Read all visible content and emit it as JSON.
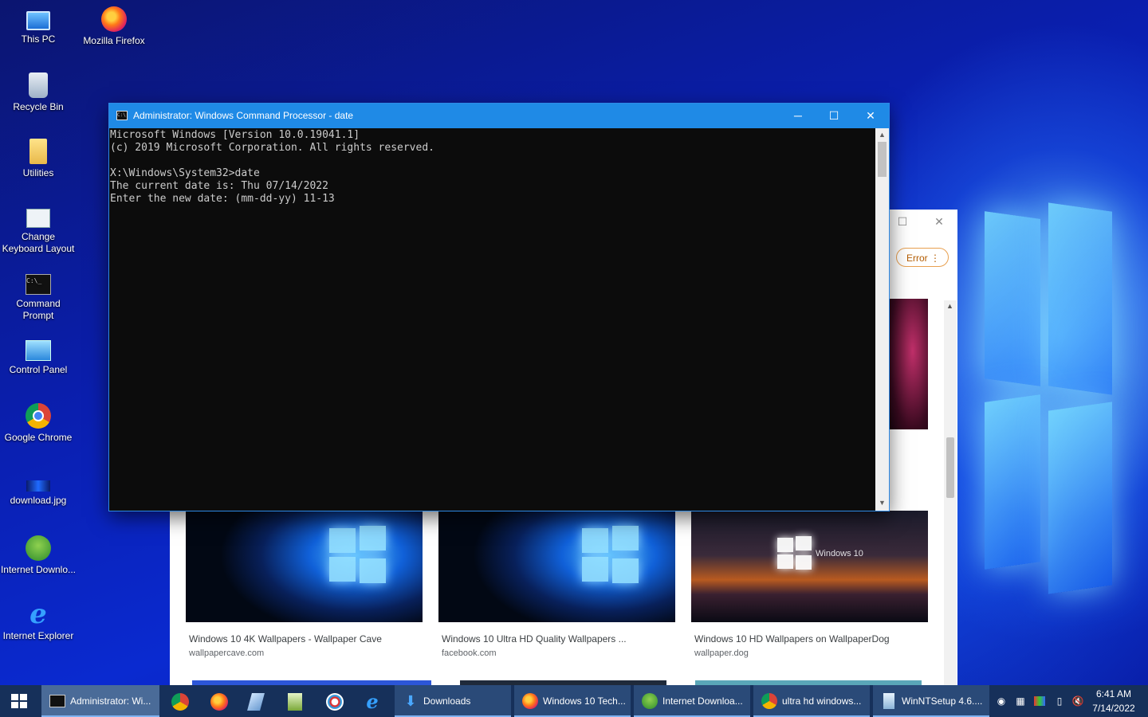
{
  "desktop": {
    "icons": [
      {
        "label": "This PC",
        "icon": "computer-icon"
      },
      {
        "label": "Mozilla Firefox",
        "icon": "firefox-icon"
      },
      {
        "label": "Recycle Bin",
        "icon": "recycle-bin-icon"
      },
      {
        "label": "Utilities",
        "icon": "folder-icon"
      },
      {
        "label": "Change Keyboard Layout",
        "icon": "keyboard-settings-icon"
      },
      {
        "label": "Command Prompt",
        "icon": "command-prompt-icon"
      },
      {
        "label": "Control Panel",
        "icon": "control-panel-icon"
      },
      {
        "label": "Google Chrome",
        "icon": "chrome-icon"
      },
      {
        "label": "download.jpg",
        "icon": "image-file-icon"
      },
      {
        "label": "Internet Downlo...",
        "icon": "internet-download-manager-icon"
      },
      {
        "label": "Internet Explorer",
        "icon": "internet-explorer-icon"
      }
    ]
  },
  "cmd": {
    "title": "Administrator: Windows Command Processor - date",
    "lines": [
      "Microsoft Windows [Version 10.0.19041.1]",
      "(c) 2019 Microsoft Corporation. All rights reserved.",
      "",
      "X:\\Windows\\System32>date",
      "The current date is: Thu 07/14/2022",
      "Enter the new date: (mm-dd-yy) 11-13"
    ],
    "controls": {
      "minimize": "─",
      "maximize": "☐",
      "close": "✕"
    }
  },
  "browser": {
    "error_label": "Error",
    "results": [
      {
        "title": "Windows 10 4K Wallpapers - Wallpaper Cave",
        "source": "wallpapercave.com"
      },
      {
        "title": "Windows 10 Ultra HD Quality Wallpapers ...",
        "source": "facebook.com"
      },
      {
        "title": "Windows 10 HD Wallpapers on WallpaperDog",
        "source": "wallpaper.dog",
        "overlay_text": "Windows 10"
      }
    ]
  },
  "taskbar": {
    "buttons": [
      {
        "label": "Administrator: Wi...",
        "icon": "command-prompt-icon",
        "active": true
      },
      {
        "label": "Downloads",
        "icon": "download-arrow-icon"
      },
      {
        "label": "Windows 10 Tech...",
        "icon": "firefox-icon"
      },
      {
        "label": "Internet Downloa...",
        "icon": "internet-download-manager-icon"
      },
      {
        "label": "ultra hd windows...",
        "icon": "chrome-icon"
      },
      {
        "label": "WinNTSetup 4.6....",
        "icon": "setup-icon"
      }
    ],
    "pinned": [
      "chrome-icon",
      "firefox-icon",
      "eraser-icon",
      "notepad-icon",
      "paint-icon",
      "internet-explorer-icon"
    ],
    "clock": {
      "time": "6:41 AM",
      "date": "7/14/2022"
    }
  }
}
